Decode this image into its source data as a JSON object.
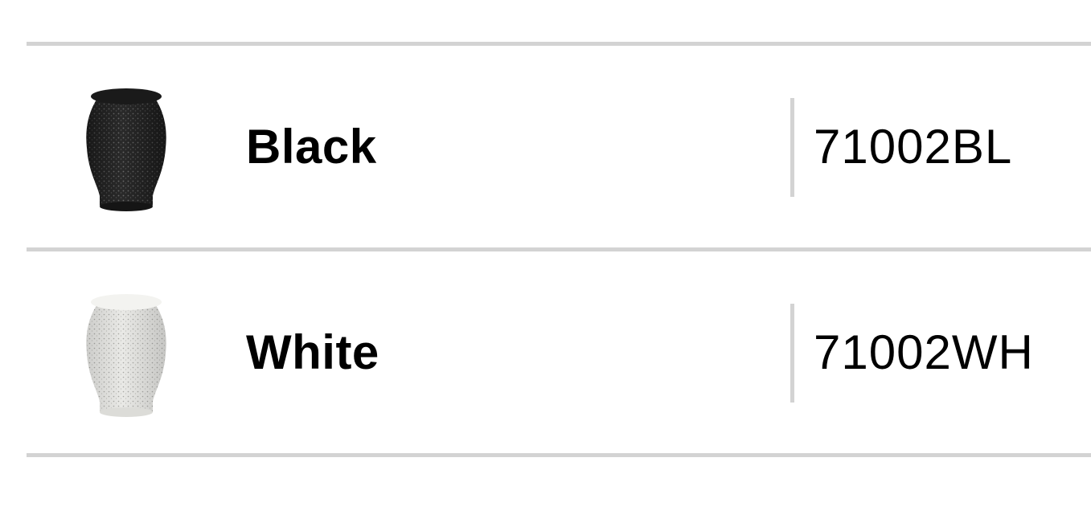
{
  "variants": [
    {
      "color_name": "Black",
      "code": "71002BL",
      "swatch": {
        "icon": "black-vase-stool-image",
        "base": "#2a2a2a",
        "speckle": "#6a6a6a",
        "top": "#1a1a1a"
      }
    },
    {
      "color_name": "White",
      "code": "71002WH",
      "swatch": {
        "icon": "white-vase-stool-image",
        "base": "#e9e9e6",
        "speckle": "#a8a8a4",
        "top": "#f3f3f0"
      }
    }
  ],
  "colors": {
    "rule": "#d3d3d3",
    "text": "#000000"
  }
}
